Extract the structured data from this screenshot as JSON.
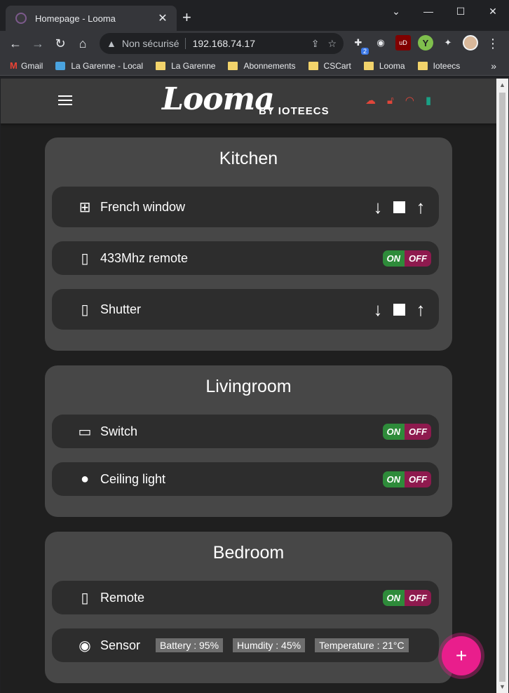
{
  "browser": {
    "tab_title": "Homepage - Looma",
    "security_label": "Non sécurisé",
    "url": "192.168.74.17",
    "extension_badge": "2",
    "bookmarks": [
      "Gmail",
      "La Garenne - Local",
      "La Garenne",
      "Abonnements",
      "CSCart",
      "Looma",
      "Ioteecs"
    ]
  },
  "app": {
    "logo": "Looma",
    "logo_sub": "BY IOTEECS",
    "status_colors": {
      "cloud": "#e0463a",
      "lock": "#e0463a",
      "wifi": "#e0463a",
      "signal": "#1aa085"
    }
  },
  "controls": {
    "on_label": "ON",
    "off_label": "OFF",
    "add_label": "+"
  },
  "rooms": [
    {
      "name": "Kitchen",
      "devices": [
        {
          "name": "French window",
          "icon": "window-icon"
        },
        {
          "name": "433Mhz remote",
          "icon": "remote-icon"
        },
        {
          "name": "Shutter",
          "icon": "remote-icon"
        }
      ]
    },
    {
      "name": "Livingroom",
      "devices": [
        {
          "name": "Switch",
          "icon": "switch-icon"
        },
        {
          "name": "Ceiling light",
          "icon": "bulb-icon"
        }
      ]
    },
    {
      "name": "Bedroom",
      "devices": [
        {
          "name": "Remote",
          "icon": "remote-icon"
        },
        {
          "name": "Sensor",
          "icon": "sensor-icon",
          "readings": [
            "Battery : 95%",
            "Humdity : 45%",
            "Temperature : 21°C"
          ]
        }
      ]
    }
  ]
}
